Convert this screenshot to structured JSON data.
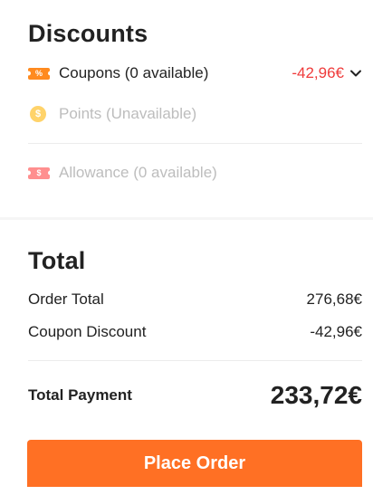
{
  "discounts": {
    "title": "Discounts",
    "coupons_label": "Coupons (0 available)",
    "coupons_value": "-42,96€",
    "points_label": "Points (Unavailable)",
    "allowance_label": "Allowance (0 available)",
    "coupon_icon_glyph": "%",
    "points_icon_glyph": "$",
    "allowance_icon_glyph": "$"
  },
  "total": {
    "title": "Total",
    "order_total_label": "Order Total",
    "order_total_value": "276,68€",
    "coupon_discount_label": "Coupon Discount",
    "coupon_discount_value": "-42,96€",
    "payment_label": "Total Payment",
    "payment_value": "233,72€"
  },
  "actions": {
    "place_order_label": "Place Order"
  },
  "colors": {
    "accent": "#ff7024",
    "discount_red": "#ef3b3b",
    "disabled_text": "#bdbdbd"
  }
}
